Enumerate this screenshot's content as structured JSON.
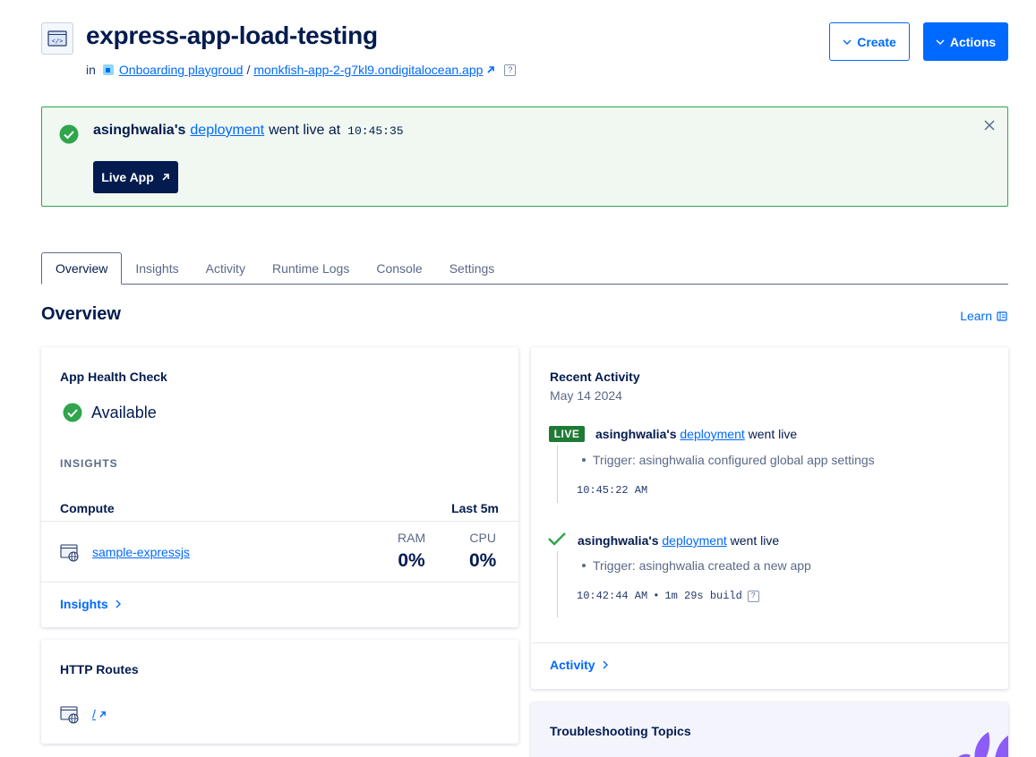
{
  "header": {
    "title": "express-app-load-testing",
    "in_label": "in",
    "project_name": "Onboarding playgroud",
    "separator": "/",
    "app_url": "monkfish-app-2-g7kl9.ondigitalocean.app",
    "help_glyph": "?"
  },
  "buttons": {
    "create": "Create",
    "actions": "Actions"
  },
  "banner": {
    "user": "asinghwalia's",
    "link": "deployment",
    "text": "went live at",
    "time": "10:45:35",
    "live_app": "Live App"
  },
  "tabs": [
    {
      "label": "Overview"
    },
    {
      "label": "Insights"
    },
    {
      "label": "Activity"
    },
    {
      "label": "Runtime Logs"
    },
    {
      "label": "Console"
    },
    {
      "label": "Settings"
    }
  ],
  "overview": {
    "title": "Overview",
    "learn": "Learn"
  },
  "health": {
    "title": "App Health Check",
    "status": "Available",
    "insights_label": "INSIGHTS",
    "compute_label": "Compute",
    "window_label": "Last 5m",
    "component": "sample-expressjs",
    "ram_label": "RAM",
    "ram_value": "0%",
    "cpu_label": "CPU",
    "cpu_value": "0%",
    "insights_link": "Insights"
  },
  "routes": {
    "title": "HTTP Routes",
    "route": "/"
  },
  "activity": {
    "title": "Recent Activity",
    "date": "May 14 2024",
    "items": [
      {
        "badge": "LIVE",
        "user": "asinghwalia's",
        "link": "deployment",
        "text": "went live",
        "trigger": "Trigger: asinghwalia configured global app settings",
        "time": "10:45:22 AM"
      },
      {
        "user": "asinghwalia's",
        "link": "deployment",
        "text": "went live",
        "trigger": "Trigger: asinghwalia created a new app",
        "time": "10:42:44 AM",
        "sep": "•",
        "build": "1m 29s build",
        "help_glyph": "?"
      }
    ],
    "footer_link": "Activity"
  },
  "troubleshooting": {
    "title": "Troubleshooting Topics"
  },
  "colors": {
    "brand_blue": "#0069ff",
    "navy": "#031b4e",
    "success_green": "#2fa54c",
    "live_badge": "#1f7a35",
    "banner_bg": "#f0f8f1"
  },
  "icons": [
    "code-icon",
    "project-icon",
    "external-link-icon",
    "help-icon",
    "chevron-down-icon",
    "check-circle-icon",
    "close-icon",
    "arrow-up-right-icon",
    "book-icon",
    "globe-window-icon",
    "chevron-right-icon",
    "checkmark-icon",
    "decorative-leaf-icon"
  ]
}
